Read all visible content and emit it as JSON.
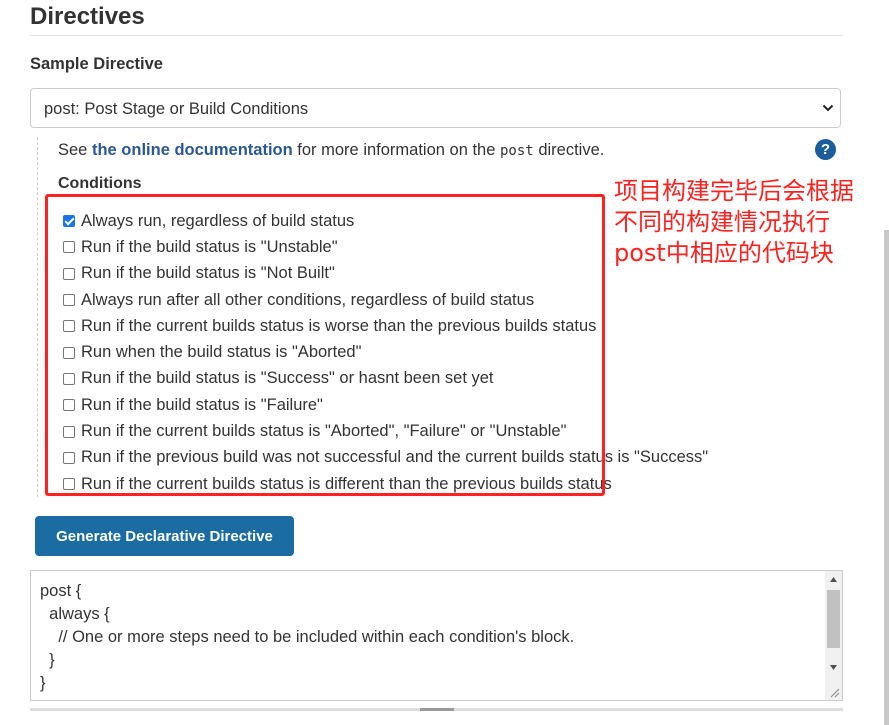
{
  "section": {
    "title": "Directives"
  },
  "sample": {
    "label": "Sample Directive",
    "selected": "post: Post Stage or Build Conditions"
  },
  "help": {
    "see": "See",
    "link": "the online documentation",
    "middle": "for more information on the",
    "code": "post",
    "end": "directive.",
    "icon_text": "?"
  },
  "conditions": {
    "label": "Conditions",
    "items": [
      {
        "label": "Always run, regardless of build status",
        "checked": true
      },
      {
        "label": "Run if the build status is \"Unstable\"",
        "checked": false
      },
      {
        "label": "Run if the build status is \"Not Built\"",
        "checked": false
      },
      {
        "label": "Always run after all other conditions, regardless of build status",
        "checked": false
      },
      {
        "label": "Run if the current builds status is worse than the previous builds status",
        "checked": false
      },
      {
        "label": "Run when the build status is \"Aborted\"",
        "checked": false
      },
      {
        "label": "Run if the build status is \"Success\" or hasnt been set yet",
        "checked": false
      },
      {
        "label": "Run if the build status is \"Failure\"",
        "checked": false
      },
      {
        "label": "Run if the current builds status is \"Aborted\", \"Failure\" or \"Unstable\"",
        "checked": false
      },
      {
        "label": "Run if the previous build was not successful and the current builds status is \"Success\"",
        "checked": false
      },
      {
        "label": "Run if the current builds status is different than the previous builds status",
        "checked": false
      }
    ]
  },
  "annotation": {
    "lines": [
      "项目构建完毕后会根据",
      "不同的构建情况执行",
      "post中相应的代码块"
    ],
    "color": "#ff2020"
  },
  "generate_button": {
    "label": "Generate Declarative Directive",
    "color": "#1c6ca4"
  },
  "output": {
    "text": "post {\n  always {\n    // One or more steps need to be included within each condition's block.\n  }\n}"
  }
}
